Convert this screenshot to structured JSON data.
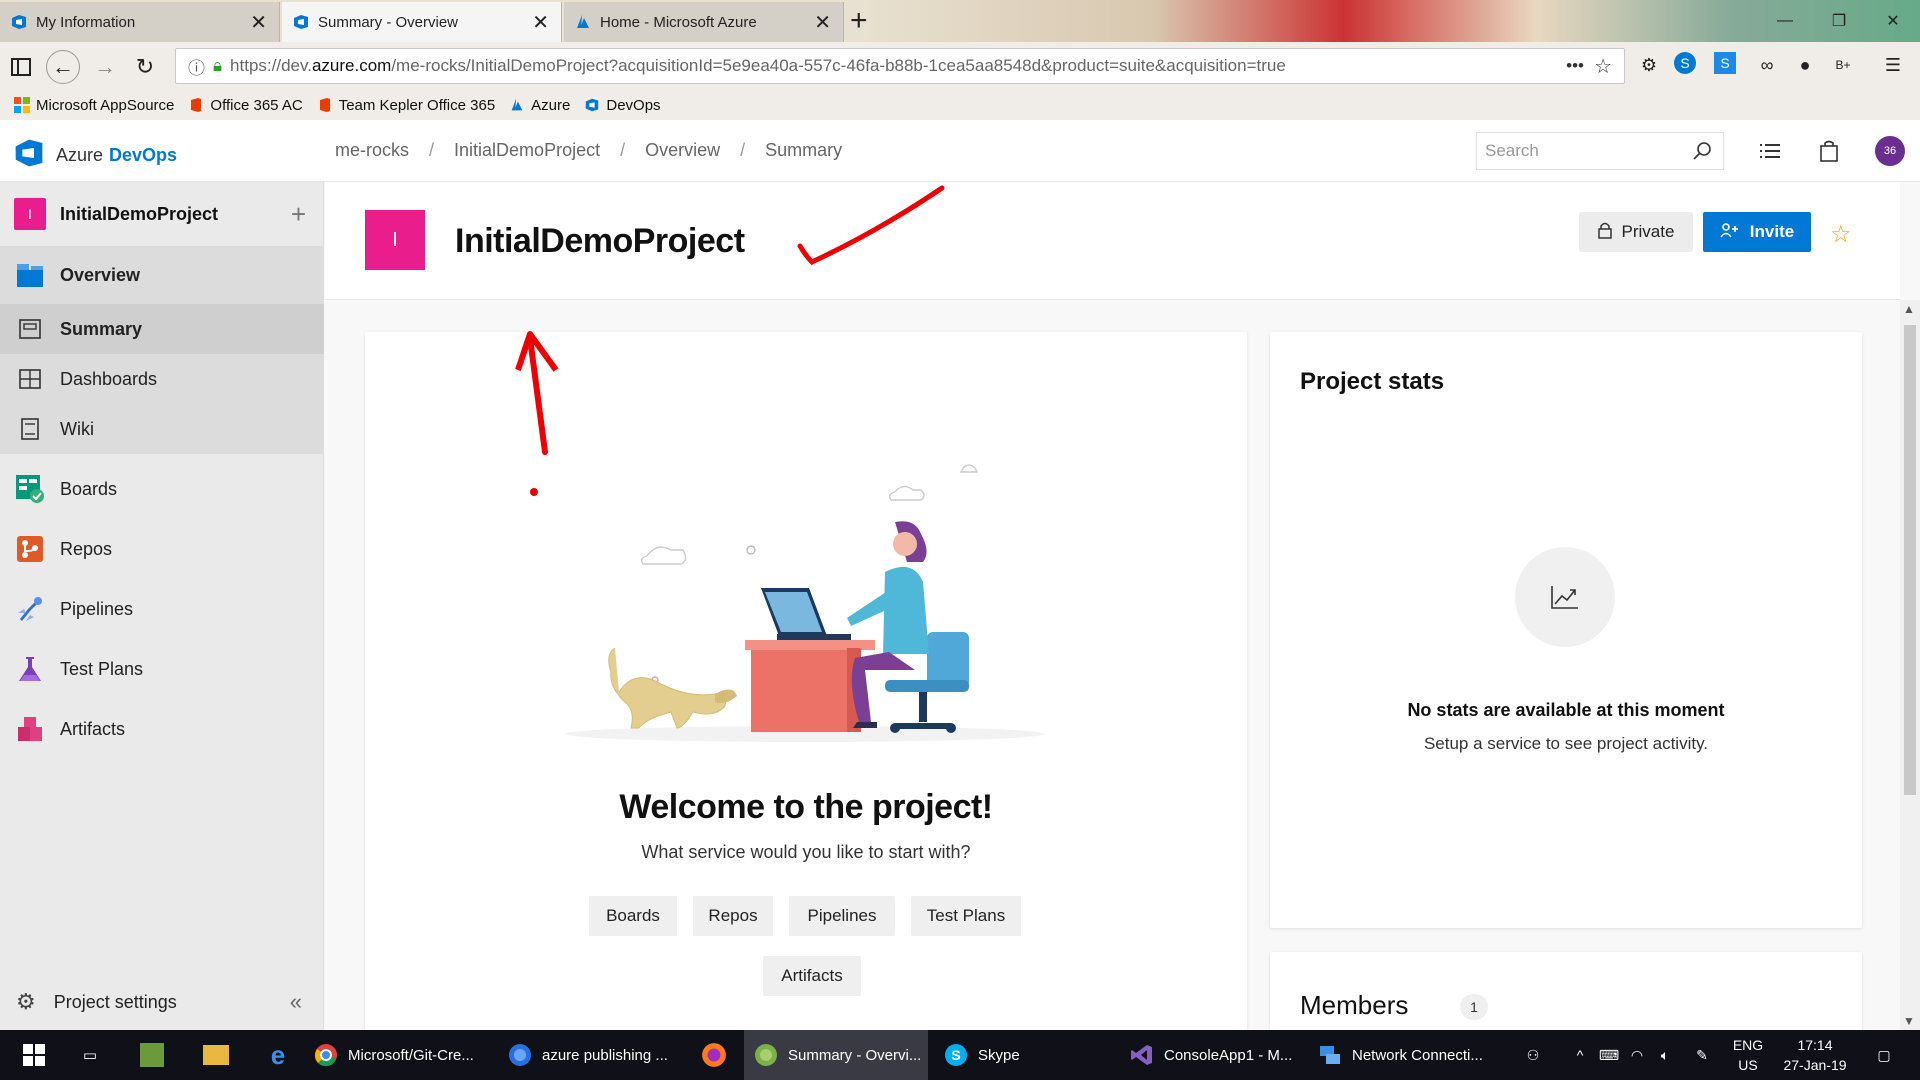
{
  "browser": {
    "tabs": [
      {
        "title": "My Information",
        "icon": "devops-icon"
      },
      {
        "title": "Summary - Overview",
        "icon": "devops-icon"
      },
      {
        "title": "Home - Microsoft Azure",
        "icon": "azure-icon"
      }
    ],
    "url_prefix": "https://dev.",
    "url_host": "azure.com",
    "url_path": "/me-rocks/InitialDemoProject?acquisitionId=5e9ea40a-557c-46fa-b88b-1cea5aa8548d&product=suite&acquisition=true",
    "bookmarks": [
      "Microsoft AppSource",
      "Office 365 AC",
      "Team Kepler Office 365",
      "Azure",
      "DevOps"
    ]
  },
  "app": {
    "brand_a": "Azure",
    "brand_b": "DevOps",
    "breadcrumb": [
      "me-rocks",
      "InitialDemoProject",
      "Overview",
      "Summary"
    ],
    "search_placeholder": "Search",
    "avatar_initials": "36",
    "accent": "#0078d4",
    "project_color": "#e91e8c"
  },
  "sidebar": {
    "project_initial": "I",
    "project_name": "InitialDemoProject",
    "items": [
      {
        "label": "Overview"
      },
      {
        "label": "Summary"
      },
      {
        "label": "Dashboards"
      },
      {
        "label": "Wiki"
      },
      {
        "label": "Boards"
      },
      {
        "label": "Repos"
      },
      {
        "label": "Pipelines"
      },
      {
        "label": "Test Plans"
      },
      {
        "label": "Artifacts"
      }
    ],
    "settings_label": "Project settings"
  },
  "main": {
    "project_initial": "I",
    "project_title": "InitialDemoProject",
    "private_label": "Private",
    "invite_label": "Invite",
    "welcome_title": "Welcome to the project!",
    "welcome_sub": "What service would you like to start with?",
    "services": [
      "Boards",
      "Repos",
      "Pipelines",
      "Test Plans",
      "Artifacts"
    ],
    "stats_title": "Project stats",
    "stats_none": "No stats are available at this moment",
    "stats_setup": "Setup a service to see project activity.",
    "members_title": "Members",
    "members_count": "1"
  },
  "taskbar": {
    "apps": [
      {
        "label": "Microsoft/Git-Cre..."
      },
      {
        "label": "azure publishing ..."
      },
      {
        "label": "Summary - Overvi..."
      },
      {
        "label": "Skype"
      },
      {
        "label": "ConsoleApp1 - M..."
      },
      {
        "label": "Network Connecti..."
      }
    ],
    "lang_1": "ENG",
    "lang_2": "US",
    "time": "17:14",
    "date": "27-Jan-19"
  }
}
